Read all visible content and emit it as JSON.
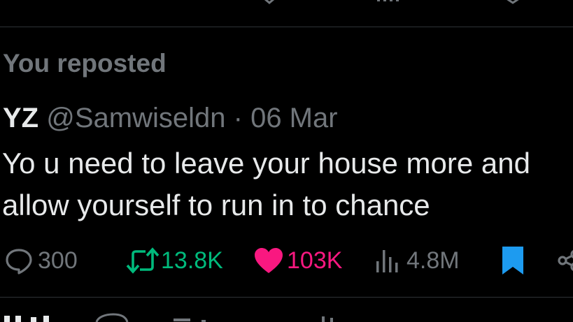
{
  "repost_label": "You reposted",
  "post": {
    "author_name": "YZ",
    "author_handle": "@Samwiseldn",
    "separator": "·",
    "date": "06 Mar",
    "text_line_1": "Yo u need to leave your house more and",
    "text_line_2": "allow yourself to run in to chance"
  },
  "actions": {
    "reply_count": "300",
    "repost_count": "13.8K",
    "like_count": "103K",
    "view_count": "4.8M"
  },
  "colors": {
    "background": "#000000",
    "text": "#e7e9ea",
    "muted": "#71767b",
    "repost_active": "#00ba7c",
    "like_active": "#f91880",
    "bookmark_active": "#1d9bf0",
    "divider": "#2f3336"
  },
  "icons": [
    "reply-icon",
    "repost-icon",
    "like-icon",
    "views-icon",
    "bookmark-icon",
    "share-icon"
  ]
}
